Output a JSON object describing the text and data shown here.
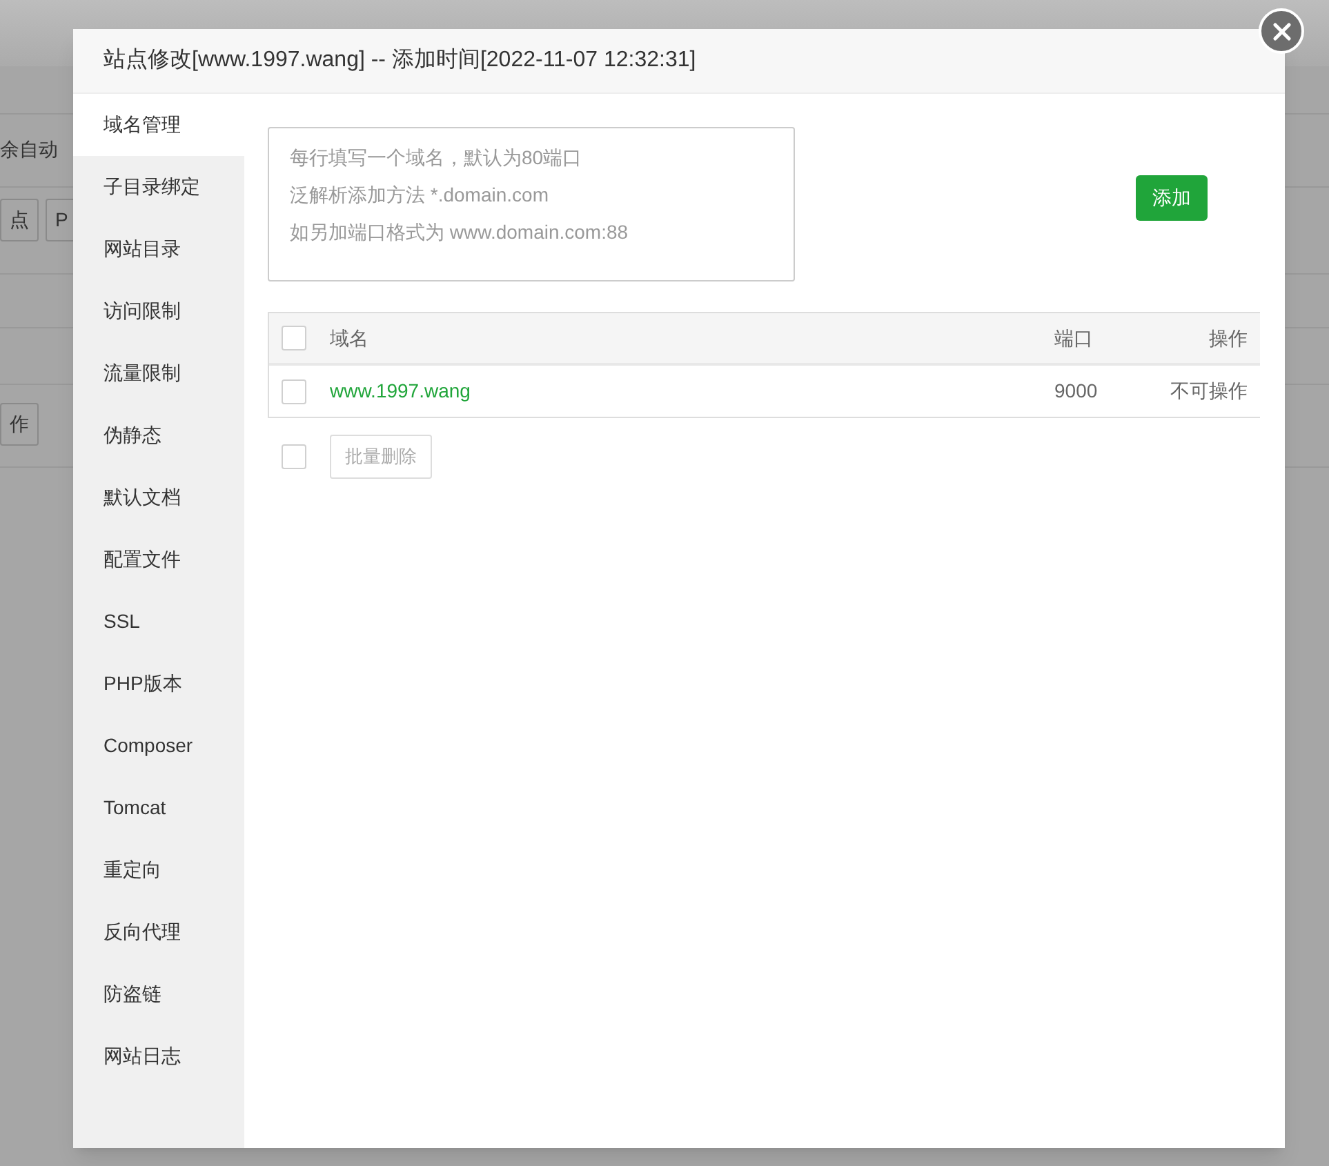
{
  "background": {
    "texts": [
      {
        "kind": "text",
        "text": "余自动"
      },
      {
        "kind": "button",
        "text": "点"
      },
      {
        "kind": "button",
        "text": "P"
      },
      {
        "kind": "button",
        "text": "作"
      }
    ]
  },
  "dialog": {
    "title": "站点修改[www.1997.wang] -- 添加时间[2022-11-07 12:32:31]",
    "menu": [
      {
        "label": "域名管理",
        "selected": true
      },
      {
        "label": "子目录绑定",
        "selected": false
      },
      {
        "label": "网站目录",
        "selected": false
      },
      {
        "label": "访问限制",
        "selected": false
      },
      {
        "label": "流量限制",
        "selected": false
      },
      {
        "label": "伪静态",
        "selected": false
      },
      {
        "label": "默认文档",
        "selected": false
      },
      {
        "label": "配置文件",
        "selected": false
      },
      {
        "label": "SSL",
        "selected": false
      },
      {
        "label": "PHP版本",
        "selected": false
      },
      {
        "label": "Composer",
        "selected": false
      },
      {
        "label": "Tomcat",
        "selected": false
      },
      {
        "label": "重定向",
        "selected": false
      },
      {
        "label": "反向代理",
        "selected": false
      },
      {
        "label": "防盗链",
        "selected": false
      },
      {
        "label": "网站日志",
        "selected": false
      }
    ],
    "domain_input": {
      "placeholder": [
        "每行填写一个域名，默认为80端口",
        "泛解析添加方法 *.domain.com",
        "如另加端口格式为 www.domain.com:88"
      ]
    },
    "add_button": "添加",
    "table": {
      "all_checked": false,
      "columns": [
        "域名",
        "端口",
        "操作"
      ],
      "rows": [
        {
          "checked": false,
          "domain": "www.1997.wang",
          "port": "9000",
          "action": "不可操作"
        }
      ]
    },
    "batch_checked": false,
    "batch_delete": "批量删除"
  }
}
